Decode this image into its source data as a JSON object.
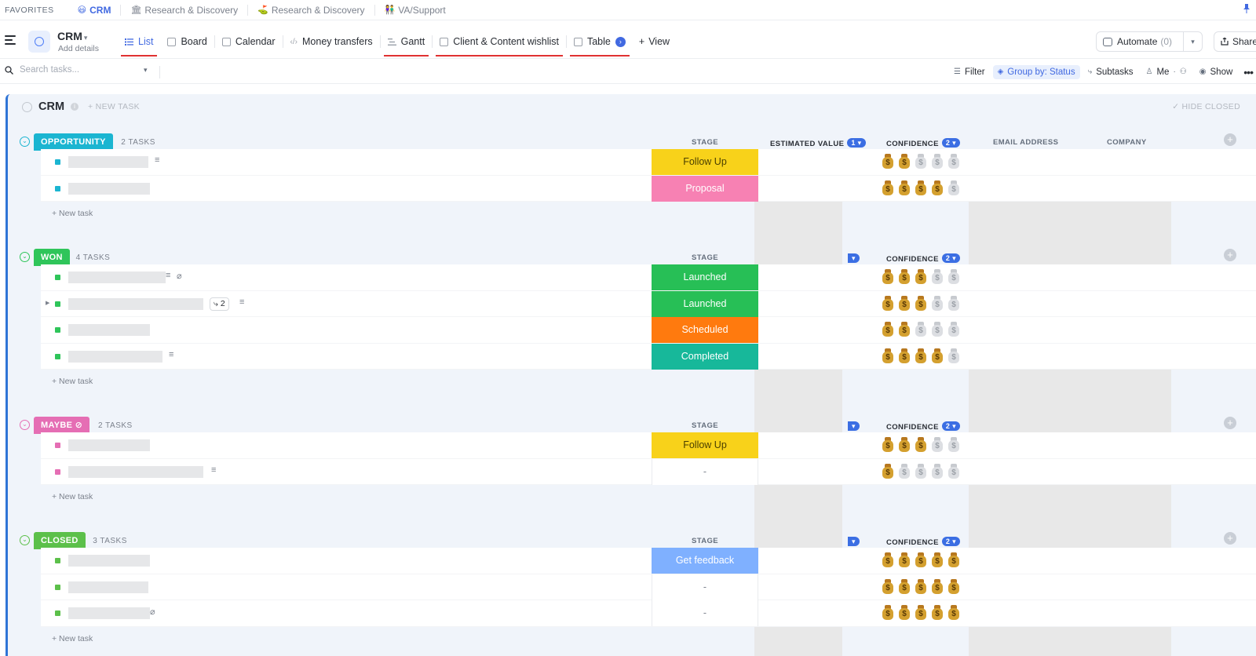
{
  "favorites": {
    "title": "FAVORITES",
    "items": [
      {
        "emoji": "😃",
        "label": "CRM",
        "active": true
      },
      {
        "emoji": "🏛",
        "label": "Research & Discovery",
        "active": false
      },
      {
        "emoji": "⛳",
        "label": "Research & Discovery",
        "active": false
      },
      {
        "emoji": "👫",
        "label": "VA/Support",
        "active": false
      }
    ]
  },
  "header": {
    "title": "CRM",
    "subtitle": "Add details",
    "views": [
      {
        "label": "List",
        "active": true
      },
      {
        "label": "Board"
      },
      {
        "label": "Calendar"
      },
      {
        "label": "Money transfers"
      },
      {
        "label": "Gantt"
      },
      {
        "label": "Client & Content wishlist"
      },
      {
        "label": "Table"
      }
    ],
    "add_view": "View",
    "automate": "Automate",
    "automate_count": "(0)",
    "share": "Share"
  },
  "toolbar": {
    "search_placeholder": "Search tasks...",
    "filter": "Filter",
    "group_by": "Group by: Status",
    "subtasks": "Subtasks",
    "me": "Me",
    "show": "Show"
  },
  "list": {
    "title": "CRM",
    "new_task": "+ NEW TASK",
    "hide_closed": "HIDE CLOSED",
    "columns": {
      "stage": "STAGE",
      "estimated_value": "ESTIMATED VALUE",
      "estimated_value_count": "1",
      "confidence": "CONFIDENCE",
      "confidence_count": "2",
      "email": "EMAIL ADDRESS",
      "company": "COMPANY"
    },
    "new_task_row": "+ New task",
    "groups": [
      {
        "status": "OPPORTUNITY",
        "count": "2 TASKS",
        "color": "#1bb5d1",
        "tasks": [
          {
            "stage": "Follow Up",
            "stage_color": "#f8d21a",
            "confidence": 2
          },
          {
            "stage": "Proposal",
            "stage_color": "#f781b3",
            "confidence": 4
          }
        ]
      },
      {
        "status": "WON",
        "count": "4 TASKS",
        "color": "#2fc55a",
        "tasks": [
          {
            "stage": "Launched",
            "stage_color": "#27bf56",
            "confidence": 3
          },
          {
            "stage": "Launched",
            "stage_color": "#27bf56",
            "confidence": 3,
            "subtasks": "2"
          },
          {
            "stage": "Scheduled",
            "stage_color": "#ff7a0e",
            "confidence": 2
          },
          {
            "stage": "Completed",
            "stage_color": "#17b89a",
            "confidence": 4
          }
        ]
      },
      {
        "status": "MAYBE",
        "count": "2 TASKS",
        "color": "#e56eb4",
        "tasks": [
          {
            "stage": "Follow Up",
            "stage_color": "#f8d21a",
            "confidence": 3
          },
          {
            "stage": "-",
            "stage_color": "",
            "confidence": 1
          }
        ]
      },
      {
        "status": "CLOSED",
        "count": "3 TASKS",
        "color": "#5cc04a",
        "tasks": [
          {
            "stage": "Get feedback",
            "stage_color": "#7fb0ff",
            "confidence": 5
          },
          {
            "stage": "-",
            "stage_color": "",
            "confidence": 5
          },
          {
            "stage": "-",
            "stage_color": "",
            "confidence": 5
          }
        ]
      }
    ]
  }
}
